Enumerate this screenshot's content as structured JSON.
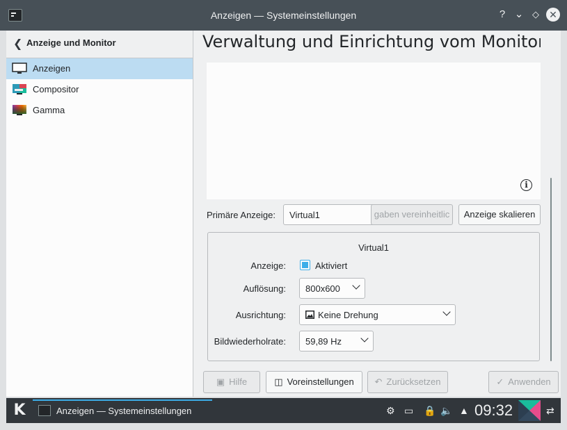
{
  "window": {
    "title": "Anzeigen — Systemeinstellungen"
  },
  "sidebar": {
    "back_label": "Anzeige und Monitor",
    "items": [
      {
        "label": "Anzeigen",
        "icon": "monitor-icon",
        "active": true
      },
      {
        "label": "Compositor",
        "icon": "compositor-icon",
        "active": false
      },
      {
        "label": "Gamma",
        "icon": "gamma-icon",
        "active": false
      }
    ]
  },
  "main": {
    "title": "Verwaltung und Einrichtung vom Monitoren",
    "primary_label": "Primäre Anzeige:",
    "primary_value": "Virtual1",
    "unify_button": "gaben vereinheitlic",
    "scale_button": "Anzeige skalieren",
    "output": {
      "name": "Virtual1",
      "display_label": "Anzeige:",
      "enabled_label": "Aktiviert",
      "resolution_label": "Auflösung:",
      "resolution_value": "800x600",
      "orientation_label": "Ausrichtung:",
      "orientation_value": "Keine Drehung",
      "refresh_label": "Bildwiederholrate:",
      "refresh_value": "59,89 Hz"
    }
  },
  "buttons": {
    "help": "Hilfe",
    "defaults": "Voreinstellungen",
    "reset": "Zurücksetzen",
    "apply": "Anwenden"
  },
  "taskbar": {
    "task_label": "Anzeigen  — Systemeinstellungen",
    "clock": "09:32"
  },
  "colors": {
    "accent": "#3daee9",
    "titlebar": "#475057",
    "taskbar": "#31363b",
    "selection": "#bcdcf2"
  }
}
